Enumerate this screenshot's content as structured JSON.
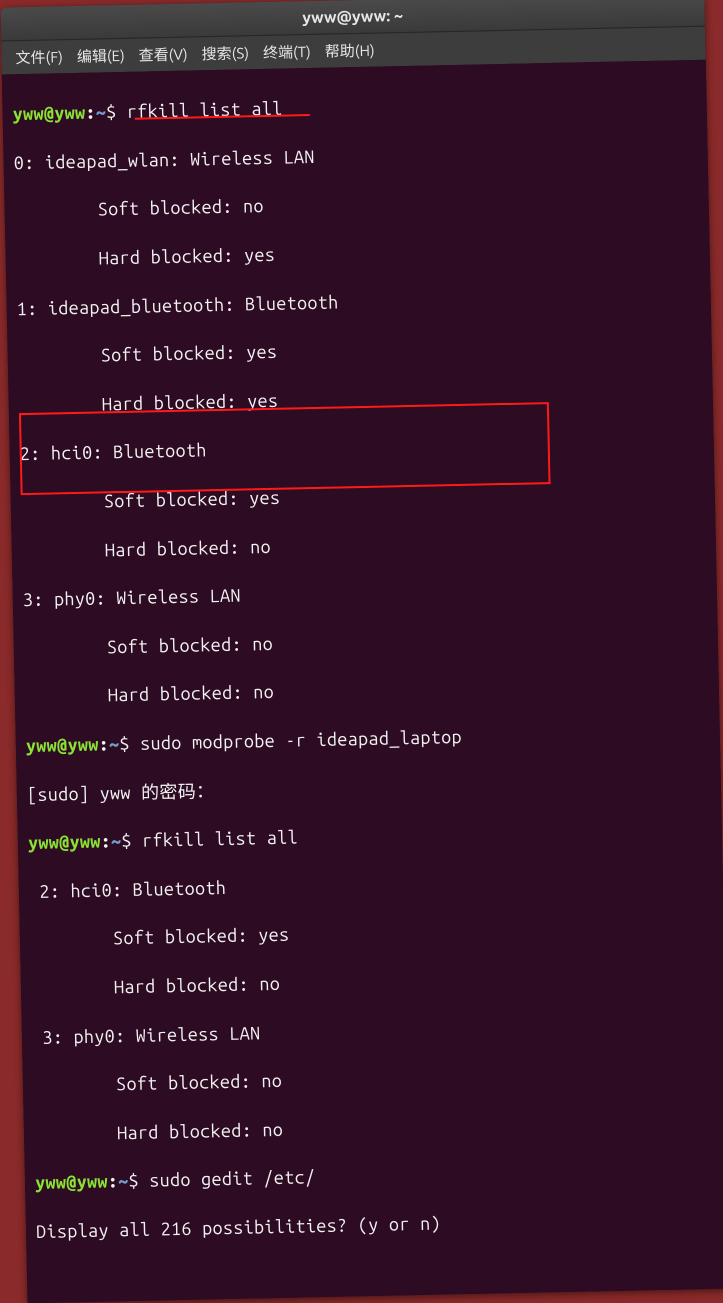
{
  "title": "yww@yww: ~",
  "menu": {
    "file": "文件(F)",
    "edit": "编辑(E)",
    "view": "查看(V)",
    "search": "搜索(S)",
    "terminal": "终端(T)",
    "help": "帮助(H)"
  },
  "p": {
    "user": "yww",
    "at": "@",
    "host": "yww",
    "colon": ":",
    "path": "~",
    "dollar": "$"
  },
  "cmd1": "rfkill list all",
  "out1": [
    "0: ideapad_wlan: Wireless LAN",
    "        Soft blocked: no",
    "        Hard blocked: yes",
    "1: ideapad_bluetooth: Bluetooth",
    "        Soft blocked: yes",
    "        Hard blocked: yes",
    "2: hci0: Bluetooth",
    "        Soft blocked: yes",
    "        Hard blocked: no",
    "3: phy0: Wireless LAN",
    "        Soft blocked: no",
    "        Hard blocked: no"
  ],
  "cmd2": "sudo modprobe -r ideapad_laptop",
  "sudo_pass": "[sudo] yww 的密码：",
  "cmd3": "rfkill list all",
  "out2": [
    " 2: hci0: Bluetooth",
    "        Soft blocked: yes",
    "        Hard blocked: no",
    " 3: phy0: Wireless LAN",
    "        Soft blocked: no",
    "        Hard blocked: no"
  ],
  "cmd4": "sudo gedit /etc/",
  "display_all": "Display all 216 possibilities? (y or n)"
}
